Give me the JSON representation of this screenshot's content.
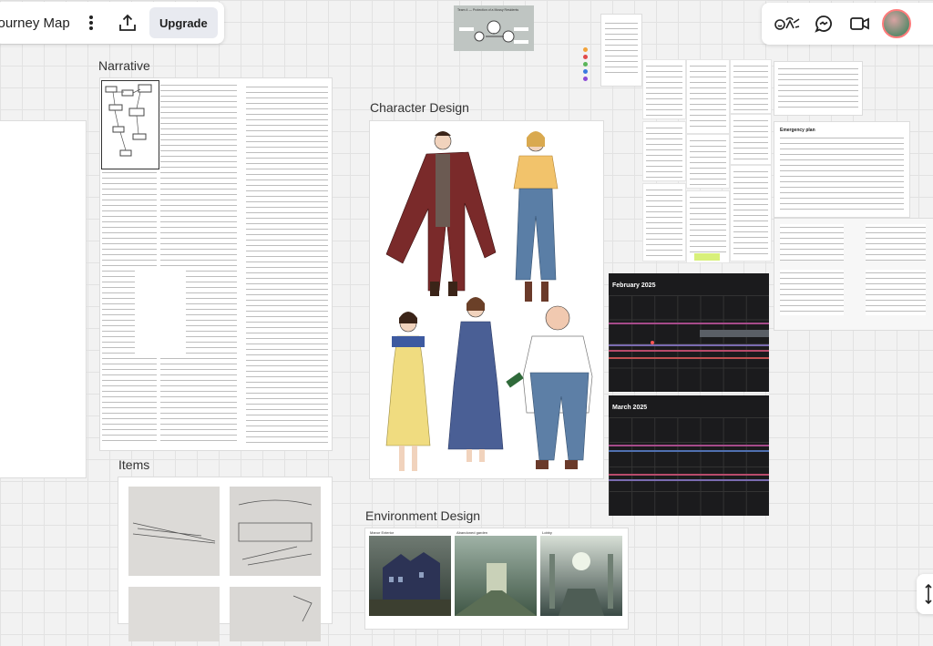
{
  "toolbar": {
    "board_title": "Journey Map",
    "upgrade_label": "Upgrade"
  },
  "frames": {
    "narrative": "Narrative",
    "character_design": "Character Design",
    "items": "Items",
    "environment_design": "Environment Design"
  },
  "thumbnail_top": {
    "title": "Team 4 — Protection of a Mossy Residents"
  },
  "calendar": {
    "feb_title": "February 2025",
    "mar_title": "March 2025"
  },
  "emergency_doc": {
    "title": "Emergency plan"
  },
  "environment_labels": [
    "Manor Exterior",
    "Abandoned garden",
    "Lobby"
  ],
  "colors": {
    "canvas": "#f2f2f2",
    "card": "#ffffff",
    "calendar_bg": "#1b1b1d",
    "upgrade_bg": "#e8eaf0"
  }
}
